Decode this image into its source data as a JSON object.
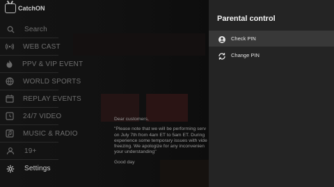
{
  "app": {
    "logo_text": "CatchON"
  },
  "sidebar": {
    "items": [
      {
        "label": "Search",
        "icon": "search-icon"
      },
      {
        "label": "WEB CAST",
        "icon": "broadcast-icon"
      },
      {
        "label": "PPV & VIP EVENT",
        "icon": "flame-icon"
      },
      {
        "label": "WORLD SPORTS",
        "icon": "ball-icon"
      },
      {
        "label": "REPLAY EVENTS",
        "icon": "calendar-icon"
      },
      {
        "label": "24/7 VIDEO",
        "icon": "clock-icon"
      },
      {
        "label": "MUSIC & RADIO",
        "icon": "music-icon"
      },
      {
        "label": "19+",
        "icon": "age-restricted-icon"
      },
      {
        "label": "Settings",
        "icon": "gear-icon"
      }
    ]
  },
  "notice": {
    "greeting": "Dear customers,",
    "body": "\"Please note that we will be performing serv\non July 7th from 4am ET to 5am ET. During\nexperience some temporary issues with vide\nfreezing. We apologize for any inconvenien\nyour understanding\"",
    "signoff": "Good day"
  },
  "panel": {
    "title": "Parental control",
    "options": [
      {
        "label": "Check PIN",
        "icon": "check-pin-icon",
        "selected": true
      },
      {
        "label": "Change PIN",
        "icon": "change-pin-icon",
        "selected": false
      }
    ]
  }
}
